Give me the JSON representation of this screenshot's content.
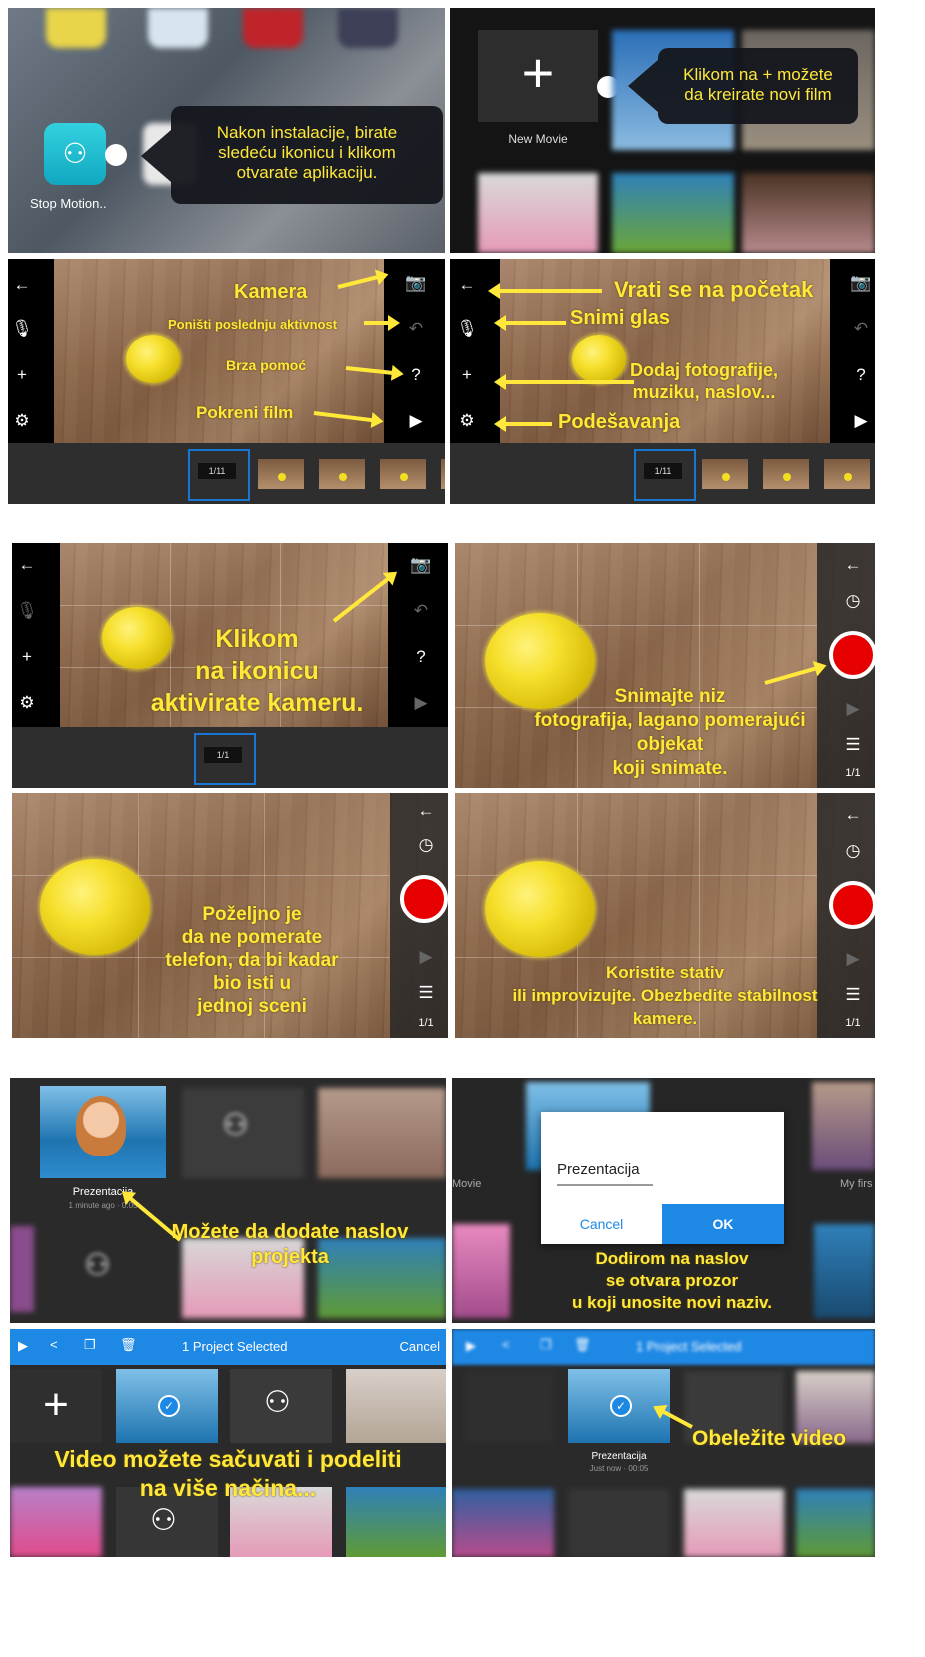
{
  "panel1": {
    "app_label": "Stop Motion..",
    "tooltip": "Nakon instalacije, birate\nsledeću ikonicu i klikom\notvarate aplikaciju."
  },
  "panel2": {
    "new_movie_label": "New Movie",
    "tooltip": "Klikom na + možete\nda kreirate novi film"
  },
  "panel3": {
    "labels": {
      "camera": "Kamera",
      "undo": "Poništi poslednju aktivnost",
      "help": "Brza pomoć",
      "play": "Pokreni film"
    },
    "frame_badge": "1/11"
  },
  "panel4": {
    "labels": {
      "back": "Vrati se na početak",
      "voice": "Snimi glas",
      "add": "Dodaj fotografije,\nmuziku, naslov...",
      "settings": "Podešavanja"
    },
    "frame_badge": "1/11"
  },
  "panel5": {
    "text": "Klikom\nna ikonicu\naktivirate kameru.",
    "frame_badge": "1/1"
  },
  "panel6": {
    "text": "Snimajte niz\nfotografija, lagano pomerajući\nobjekat\nkoji snimate.",
    "frame_count": "1/1"
  },
  "panel7": {
    "text": "Poželjno je\nda ne pomerate\ntelefon, da bi kadar\nbio isti u\njednoj sceni",
    "frame_count": "1/1"
  },
  "panel8": {
    "text": "Koristite stativ\nili improvizujte. Obezbedite stabilnost\nkamere.",
    "frame_count": "1/1"
  },
  "panel9": {
    "project_title": "Prezentacija",
    "project_meta": "1 minute ago · 0:05",
    "text": "Možete da dodate naslov\nprojekta"
  },
  "panel10": {
    "dialog_value": "Prezentacija",
    "cancel_label": "Cancel",
    "ok_label": "OK",
    "side_label_left": "Movie",
    "side_label_right": "My firs",
    "text": "Dodirom na naslov\nse otvara prozor\nu koji unosite novi naziv."
  },
  "panel11": {
    "selection_title": "1 Project Selected",
    "cancel_label": "Cancel",
    "text": "Video možete sačuvati i podeliti\nna više načina..."
  },
  "panel12": {
    "selection_title": "1 Project Selected",
    "project_title": "Prezentacija",
    "project_meta": "Just now · 00:05",
    "text": "Obeležite video"
  },
  "colors": {
    "annotation_yellow": "#ffe839",
    "app_blue": "#1e88e5",
    "record_red": "#e60000"
  }
}
